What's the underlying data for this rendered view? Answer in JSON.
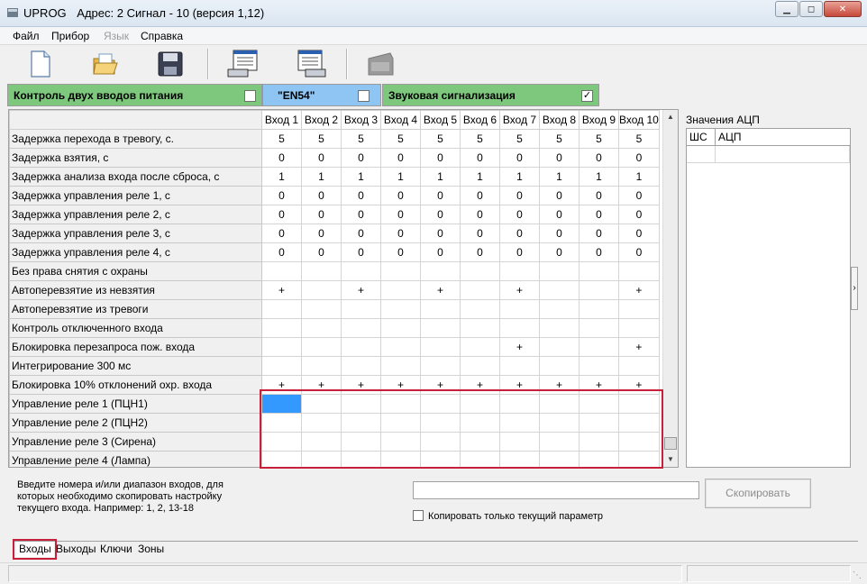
{
  "window": {
    "title_app": "UPROG",
    "title_info": "Адрес:  2  Сигнал - 10 (версия  1,12)",
    "controls": [
      "minimize",
      "maximize",
      "close"
    ]
  },
  "menu": [
    "Файл",
    "Прибор",
    "Язык",
    "Справка"
  ],
  "menu_disabled": [
    "Язык"
  ],
  "toolbar": {
    "icons": [
      "new-file-icon",
      "open-folder-icon",
      "save-disk-icon",
      "read-from-device-icon",
      "write-to-device-icon",
      "device-disabled-icon"
    ]
  },
  "options": {
    "power_control": {
      "label": "Контроль двух вводов питания",
      "checked": false
    },
    "en54": {
      "label": "\"EN54\"",
      "checked": false
    },
    "sound_alarm": {
      "label": "Звуковая сигнализация",
      "checked": true
    },
    "colors": {
      "green": "#7ec87e",
      "blue": "#8ec5f2"
    }
  },
  "grid": {
    "columns": [
      "Вход 1",
      "Вход 2",
      "Вход 3",
      "Вход 4",
      "Вход 5",
      "Вход 6",
      "Вход 7",
      "Вход 8",
      "Вход 9",
      "Вход 10"
    ],
    "rows": [
      {
        "label": "Задержка перехода в тревогу, с.",
        "values": [
          "5",
          "5",
          "5",
          "5",
          "5",
          "5",
          "5",
          "5",
          "5",
          "5"
        ]
      },
      {
        "label": "Задержка взятия, с",
        "values": [
          "0",
          "0",
          "0",
          "0",
          "0",
          "0",
          "0",
          "0",
          "0",
          "0"
        ]
      },
      {
        "label": "Задержка анализа входа после сброса, с",
        "values": [
          "1",
          "1",
          "1",
          "1",
          "1",
          "1",
          "1",
          "1",
          "1",
          "1"
        ]
      },
      {
        "label": "Задержка управления реле 1, с",
        "values": [
          "0",
          "0",
          "0",
          "0",
          "0",
          "0",
          "0",
          "0",
          "0",
          "0"
        ]
      },
      {
        "label": "Задержка управления реле 2, с",
        "values": [
          "0",
          "0",
          "0",
          "0",
          "0",
          "0",
          "0",
          "0",
          "0",
          "0"
        ]
      },
      {
        "label": "Задержка управления реле 3, с",
        "values": [
          "0",
          "0",
          "0",
          "0",
          "0",
          "0",
          "0",
          "0",
          "0",
          "0"
        ]
      },
      {
        "label": "Задержка управления реле 4, с",
        "values": [
          "0",
          "0",
          "0",
          "0",
          "0",
          "0",
          "0",
          "0",
          "0",
          "0"
        ]
      },
      {
        "label": "Без права снятия с охраны",
        "values": [
          "",
          "",
          "",
          "",
          "",
          "",
          "",
          "",
          "",
          ""
        ]
      },
      {
        "label": "Автоперевзятие из невзятия",
        "values": [
          "+",
          "",
          "+",
          "",
          "+",
          "",
          "+",
          "",
          "",
          "+"
        ]
      },
      {
        "label": "Автоперевзятие из тревоги",
        "values": [
          "",
          "",
          "",
          "",
          "",
          "",
          "",
          "",
          "",
          ""
        ]
      },
      {
        "label": "Контроль отключенного входа",
        "values": [
          "",
          "",
          "",
          "",
          "",
          "",
          "",
          "",
          "",
          ""
        ]
      },
      {
        "label": "Блокировка перезапроса пож. входа",
        "values": [
          "",
          "",
          "",
          "",
          "",
          "",
          "+",
          "",
          "",
          "+"
        ]
      },
      {
        "label": "Интегрирование 300 мс",
        "values": [
          "",
          "",
          "",
          "",
          "",
          "",
          "",
          "",
          "",
          ""
        ]
      },
      {
        "label": "Блокировка 10% отклонений охр. входа",
        "values": [
          "+",
          "+",
          "+",
          "+",
          "+",
          "+",
          "+",
          "+",
          "+",
          "+"
        ]
      },
      {
        "label": "Управление реле 1 (ПЦН1)",
        "values": [
          "",
          "",
          "",
          "",
          "",
          "",
          "",
          "",
          "",
          ""
        ]
      },
      {
        "label": "Управление реле 2 (ПЦН2)",
        "values": [
          "",
          "",
          "",
          "",
          "",
          "",
          "",
          "",
          "",
          ""
        ]
      },
      {
        "label": "Управление реле 3 (Сирена)",
        "values": [
          "",
          "",
          "",
          "",
          "",
          "",
          "",
          "",
          "",
          ""
        ]
      },
      {
        "label": "Управление реле 4 (Лампа)",
        "values": [
          "",
          "",
          "",
          "",
          "",
          "",
          "",
          "",
          "",
          ""
        ]
      }
    ],
    "selected_cell": {
      "row": 14,
      "col": 0
    },
    "selection_color": "#3399ff",
    "highlight_color": "#c8203a"
  },
  "adc": {
    "label": "Значения АЦП",
    "columns": [
      "ШС",
      "АЦП"
    ]
  },
  "bottom": {
    "hint": "Введите номера и/или диапазон входов, для которых необходимо скопировать настройку текущего входа. Например: 1, 2, 13-18",
    "range_value": "",
    "copy_button": "Скопировать",
    "only_current_label": "Копировать только текущий параметр",
    "only_current_checked": false
  },
  "tabs": [
    "Входы",
    "Выходы",
    "Ключи",
    "Зоны"
  ],
  "active_tab": "Входы"
}
